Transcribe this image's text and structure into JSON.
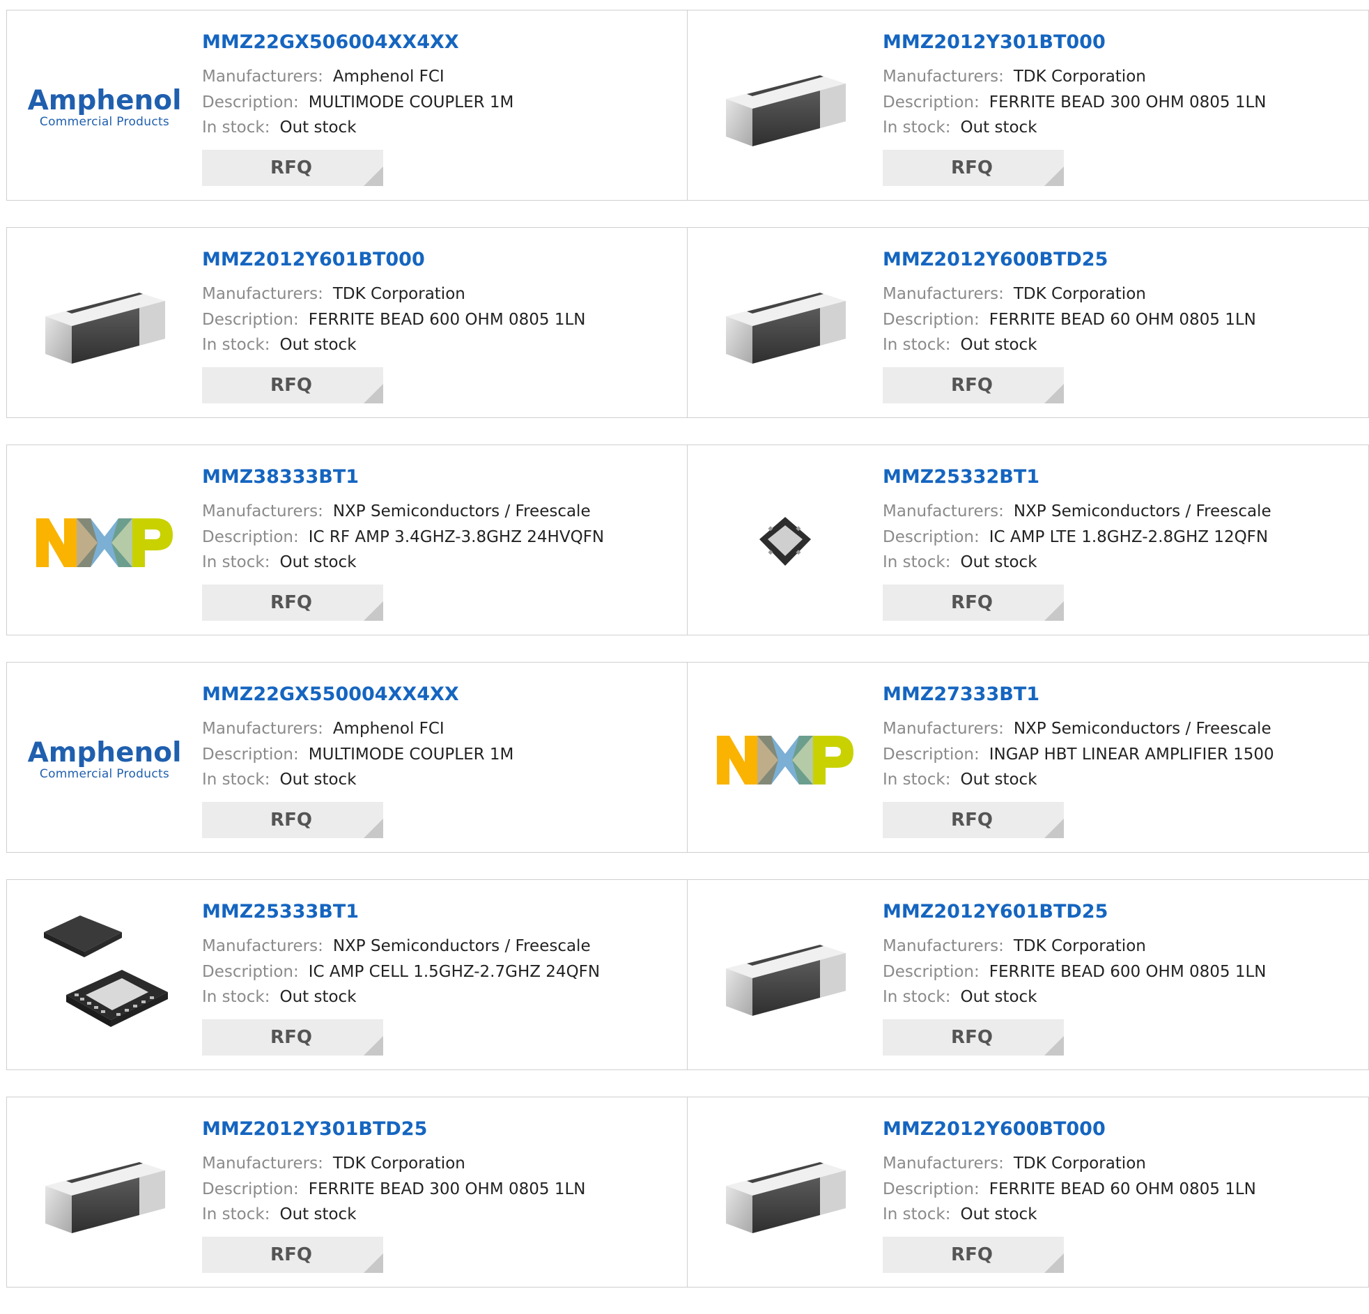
{
  "labels": {
    "manufacturers": "Manufacturers:",
    "description": "Description:",
    "in_stock": "In stock:",
    "rfq": "RFQ"
  },
  "logos": {
    "amphenol_word": "Amphenol",
    "amphenol_sub": "Commercial Products",
    "nxp_letters": [
      "N",
      "X",
      "P"
    ]
  },
  "colors": {
    "part_link": "#1565c0",
    "nxp_n": "#f9b300",
    "nxp_x": "#7bafd4",
    "nxp_p": "#c9d200"
  },
  "products": [
    {
      "part": "MMZ22GX506004XX4XX",
      "manufacturer": "Amphenol FCI",
      "description": "MULTIMODE COUPLER 1M",
      "stock": "Out stock",
      "image": "amphenol-logo"
    },
    {
      "part": "MMZ2012Y301BT000",
      "manufacturer": "TDK Corporation",
      "description": "FERRITE BEAD 300 OHM 0805 1LN",
      "stock": "Out stock",
      "image": "ferrite-bead"
    },
    {
      "part": "MMZ2012Y601BT000",
      "manufacturer": "TDK Corporation",
      "description": "FERRITE BEAD 600 OHM 0805 1LN",
      "stock": "Out stock",
      "image": "ferrite-bead"
    },
    {
      "part": "MMZ2012Y600BTD25",
      "manufacturer": "TDK Corporation",
      "description": "FERRITE BEAD 60 OHM 0805 1LN",
      "stock": "Out stock",
      "image": "ferrite-bead"
    },
    {
      "part": "MMZ38333BT1",
      "manufacturer": "NXP Semiconductors / Freescale",
      "description": "IC RF AMP 3.4GHZ-3.8GHZ 24HVQFN",
      "stock": "Out stock",
      "image": "nxp-logo"
    },
    {
      "part": "MMZ25332BT1",
      "manufacturer": "NXP Semiconductors / Freescale",
      "description": "IC AMP LTE 1.8GHZ-2.8GHZ 12QFN",
      "stock": "Out stock",
      "image": "qfn-small-chip"
    },
    {
      "part": "MMZ22GX550004XX4XX",
      "manufacturer": "Amphenol FCI",
      "description": "MULTIMODE COUPLER 1M",
      "stock": "Out stock",
      "image": "amphenol-logo"
    },
    {
      "part": "MMZ27333BT1",
      "manufacturer": "NXP Semiconductors / Freescale",
      "description": "INGAP HBT LINEAR AMPLIFIER 1500",
      "stock": "Out stock",
      "image": "nxp-logo"
    },
    {
      "part": "MMZ25333BT1",
      "manufacturer": "NXP Semiconductors / Freescale",
      "description": "IC AMP CELL 1.5GHZ-2.7GHZ 24QFN",
      "stock": "Out stock",
      "image": "qfn-chip-pair"
    },
    {
      "part": "MMZ2012Y601BTD25",
      "manufacturer": "TDK Corporation",
      "description": "FERRITE BEAD 600 OHM 0805 1LN",
      "stock": "Out stock",
      "image": "ferrite-bead"
    },
    {
      "part": "MMZ2012Y301BTD25",
      "manufacturer": "TDK Corporation",
      "description": "FERRITE BEAD 300 OHM 0805 1LN",
      "stock": "Out stock",
      "image": "ferrite-bead"
    },
    {
      "part": "MMZ2012Y600BT000",
      "manufacturer": "TDK Corporation",
      "description": "FERRITE BEAD 60 OHM 0805 1LN",
      "stock": "Out stock",
      "image": "ferrite-bead"
    }
  ]
}
